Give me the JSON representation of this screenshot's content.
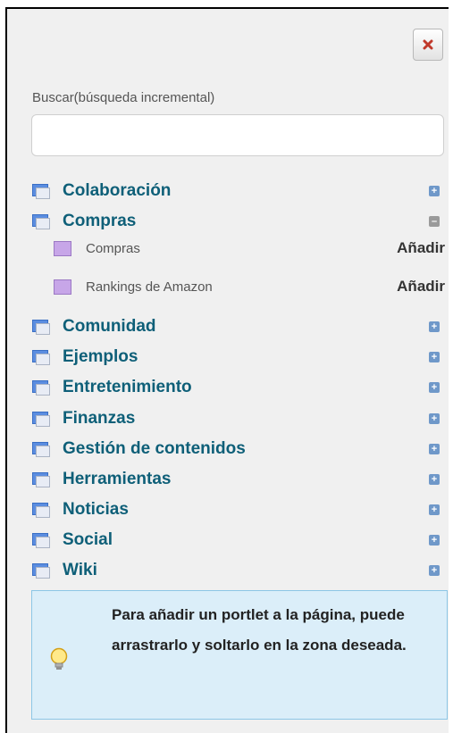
{
  "search": {
    "label": "Buscar(búsqueda incremental)",
    "value": ""
  },
  "categories": [
    {
      "label": "Colaboración",
      "expanded": false
    },
    {
      "label": "Compras",
      "expanded": true
    },
    {
      "label": "Comunidad",
      "expanded": false
    },
    {
      "label": "Ejemplos",
      "expanded": false
    },
    {
      "label": "Entretenimiento",
      "expanded": false
    },
    {
      "label": "Finanzas",
      "expanded": false
    },
    {
      "label": "Gestión de contenidos",
      "expanded": false
    },
    {
      "label": "Herramientas",
      "expanded": false
    },
    {
      "label": "Noticias",
      "expanded": false
    },
    {
      "label": "Social",
      "expanded": false
    },
    {
      "label": "Wiki",
      "expanded": false
    }
  ],
  "compras_portlets": [
    {
      "label": "Compras",
      "action": "Añadir"
    },
    {
      "label": "Rankings de Amazon",
      "action": "Añadir"
    }
  ],
  "info": {
    "message": "Para añadir un portlet a la página, puede arrastrarlo y soltarlo en la zona deseada."
  },
  "colors": {
    "category_text": "#0e5f78",
    "info_background": "#dbeef9",
    "close_icon": "#c0392b"
  }
}
